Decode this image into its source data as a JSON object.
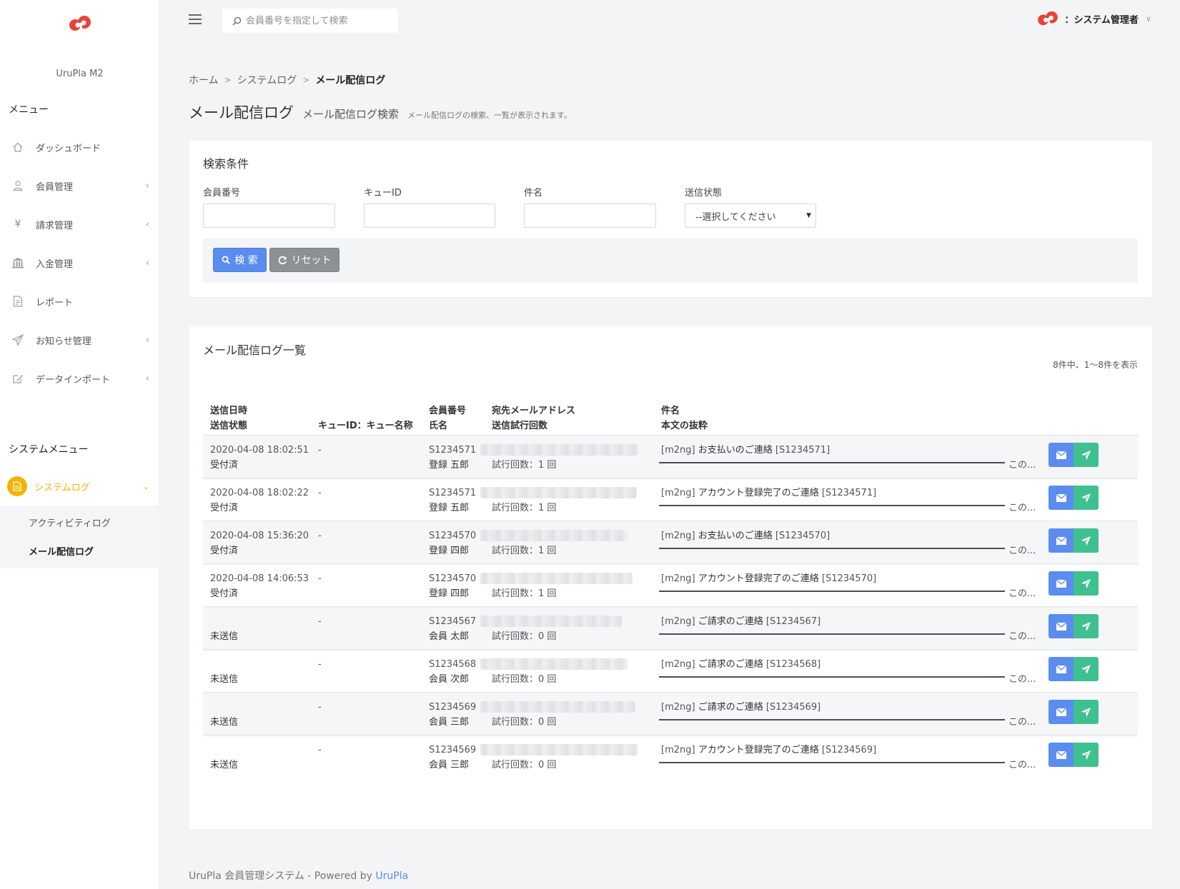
{
  "sidebar": {
    "app_name": "UruPla M2",
    "menu_heading": "メニュー",
    "items": [
      {
        "label": "ダッシュボード",
        "icon": "home-icon"
      },
      {
        "label": "会員管理",
        "icon": "user-icon"
      },
      {
        "label": "請求管理",
        "icon": "yen-icon"
      },
      {
        "label": "入金管理",
        "icon": "bank-icon"
      },
      {
        "label": "レポート",
        "icon": "document-icon"
      },
      {
        "label": "お知らせ管理",
        "icon": "paper-plane-icon"
      },
      {
        "label": "データインポート",
        "icon": "edit-icon"
      }
    ],
    "system_heading": "システムメニュー",
    "system_item": {
      "label": "システムログ",
      "icon": "document-icon"
    },
    "sub_items": [
      "アクティビティログ",
      "メール配信ログ"
    ]
  },
  "topbar": {
    "search_placeholder": "会員番号を指定して検索",
    "user_label": "：システム管理者"
  },
  "breadcrumb": [
    "ホーム",
    "システムログ",
    "メール配信ログ"
  ],
  "page": {
    "title": "メール配信ログ",
    "subtitle": "メール配信ログ検索",
    "description": "メール配信ログの検索、一覧が表示されます。"
  },
  "search": {
    "heading": "検索条件",
    "member_label": "会員番号",
    "queue_label": "キューID",
    "subject_label": "件名",
    "status_label": "送信状態",
    "status_value": "--選択してください",
    "search_button": "検 索",
    "reset_button": "リセット"
  },
  "list": {
    "heading": "メール配信ログ一覧",
    "count_text": "8件中、1〜8件を表示",
    "headers": {
      "col1_a": "送信日時",
      "col1_b": "送信状態",
      "col2": "キューID：キュー名称",
      "col3_a": "会員番号",
      "col3_b": "氏名",
      "col4_a": "宛先メールアドレス",
      "col4_b": "送信試行回数",
      "col5_a": "件名",
      "col5_b": "本文の抜粋"
    },
    "rows": [
      {
        "datetime": "2020-04-08 18:02:51",
        "status": "受付済",
        "queue": "-",
        "member_no": "S1234571",
        "name": "登録 五郎",
        "attempts": "試行回数：1 回",
        "subject_prefix": "[m2ng]",
        "subject_main": "お支払いのご連絡",
        "subject_suffix": "[S1234571]",
        "excerpt_tail": "この..."
      },
      {
        "datetime": "2020-04-08 18:02:22",
        "status": "受付済",
        "queue": "-",
        "member_no": "S1234571",
        "name": "登録 五郎",
        "attempts": "試行回数：1 回",
        "subject_prefix": "[m2ng]",
        "subject_main": "アカウント登録完了のご連絡",
        "subject_suffix": "[S1234571]",
        "excerpt_tail": "この..."
      },
      {
        "datetime": "2020-04-08 15:36:20",
        "status": "受付済",
        "queue": "-",
        "member_no": "S1234570",
        "name": "登録 四郎",
        "attempts": "試行回数：1 回",
        "subject_prefix": "[m2ng]",
        "subject_main": "お支払いのご連絡",
        "subject_suffix": "[S1234570]",
        "excerpt_tail": "この..."
      },
      {
        "datetime": "2020-04-08 14:06:53",
        "status": "受付済",
        "queue": "-",
        "member_no": "S1234570",
        "name": "登録 四郎",
        "attempts": "試行回数：1 回",
        "subject_prefix": "[m2ng]",
        "subject_main": "アカウント登録完了のご連絡",
        "subject_suffix": "[S1234570]",
        "excerpt_tail": "この..."
      },
      {
        "datetime": "",
        "status": "未送信",
        "queue": "-",
        "member_no": "S1234567",
        "name": "会員 太郎",
        "attempts": "試行回数：0 回",
        "subject_prefix": "[m2ng]",
        "subject_main": "ご請求のご連絡",
        "subject_suffix": "[S1234567]",
        "excerpt_tail": "この..."
      },
      {
        "datetime": "",
        "status": "未送信",
        "queue": "-",
        "member_no": "S1234568",
        "name": "会員 次郎",
        "attempts": "試行回数：0 回",
        "subject_prefix": "[m2ng]",
        "subject_main": "ご請求のご連絡",
        "subject_suffix": "[S1234568]",
        "excerpt_tail": "この..."
      },
      {
        "datetime": "",
        "status": "未送信",
        "queue": "-",
        "member_no": "S1234569",
        "name": "会員 三郎",
        "attempts": "試行回数：0 回",
        "subject_prefix": "[m2ng]",
        "subject_main": "ご請求のご連絡",
        "subject_suffix": "[S1234569]",
        "excerpt_tail": "この..."
      },
      {
        "datetime": "",
        "status": "未送信",
        "queue": "-",
        "member_no": "S1234569",
        "name": "会員 三郎",
        "attempts": "試行回数：0 回",
        "subject_prefix": "[m2ng]",
        "subject_main": "アカウント登録完了のご連絡",
        "subject_suffix": "[S1234569]",
        "excerpt_tail": "この..."
      }
    ]
  },
  "footer": {
    "text": "UruPla 会員管理システム - Powered by",
    "link": "UruPla"
  },
  "colors": {
    "primary": "#5b8def",
    "success": "#3fc08f",
    "active_menu": "#f3b400",
    "brand_red": "#e8423b"
  }
}
